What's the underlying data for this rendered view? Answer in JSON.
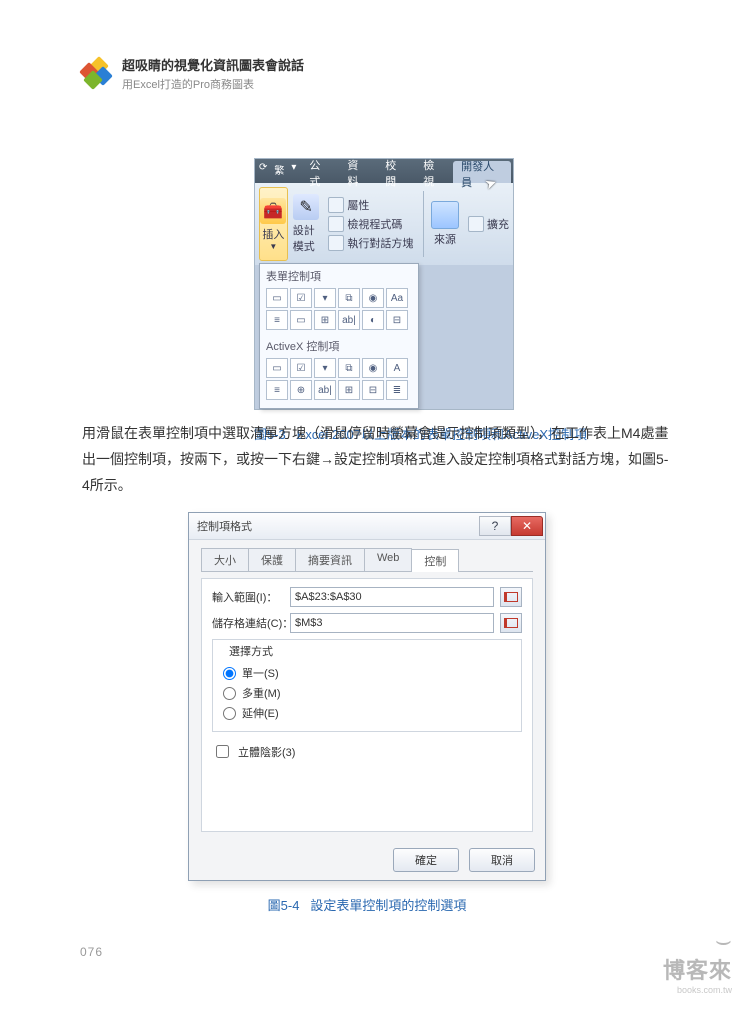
{
  "header": {
    "title": "超吸睛的視覺化資訊圖表會說話",
    "subtitle": "用Excel打造的Pro商務圖表"
  },
  "page_number": "076",
  "figure1": {
    "caption_label": "圖5-3",
    "caption_text": "Excel 2007以上版本的表單控制項和ActiveX控制項",
    "qat": "繁",
    "tabs": {
      "formula": "公式",
      "data": "資料",
      "review": "校閱",
      "view": "檢視",
      "developer": "開發人員"
    },
    "ribbon": {
      "insert": "插入",
      "design_mode": "設計模式",
      "properties": "屬性",
      "view_code": "檢視程式碼",
      "run_dialog": "執行對話方塊",
      "source": "來源",
      "expand": "擴充"
    },
    "gallery": {
      "form_section": "表單控制項",
      "activex_section": "ActiveX 控制項",
      "form_cells": [
        "▭",
        "☑",
        "▾",
        "⧉",
        "◉",
        "Aa",
        "≡",
        "▭",
        "⊞",
        "ab|",
        "◐",
        "⊟"
      ],
      "ax_cells": [
        "▭",
        "☑",
        "▾",
        "⧉",
        "◉",
        "A",
        "≡",
        "⊕",
        "ab|",
        "⊞",
        "⊟",
        "≣"
      ]
    }
  },
  "body_paragraph": "用滑鼠在表單控制項中選取清單方塊（滑鼠停留時螢幕會提示控制項類型），在工作表上M4處畫出一個控制項，按兩下，或按一下右鍵→設定控制項格式進入設定控制項格式對話方塊，如圖5-4所示。",
  "figure2": {
    "caption_label": "圖5-4",
    "caption_text": "設定表單控制項的控制選項",
    "title": "控制項格式",
    "tabs": {
      "size": "大小",
      "protect": "保護",
      "summary": "摘要資訊",
      "web": "Web",
      "control": "控制"
    },
    "input_range_label": "輸入範圍(I)：",
    "input_range_value": "$A$23:$A$30",
    "cell_link_label": "儲存格連結(C)：",
    "cell_link_value": "$M$3",
    "select_mode_label": "選擇方式",
    "radio_single": "單一(S)",
    "radio_multi": "多重(M)",
    "radio_extend": "延伸(E)",
    "checkbox_3d": "立體陰影(3)",
    "ok": "確定",
    "cancel": "取消",
    "help": "?",
    "close": "✕"
  },
  "watermark": {
    "brand": "博客來",
    "url": "books.com.tw"
  }
}
